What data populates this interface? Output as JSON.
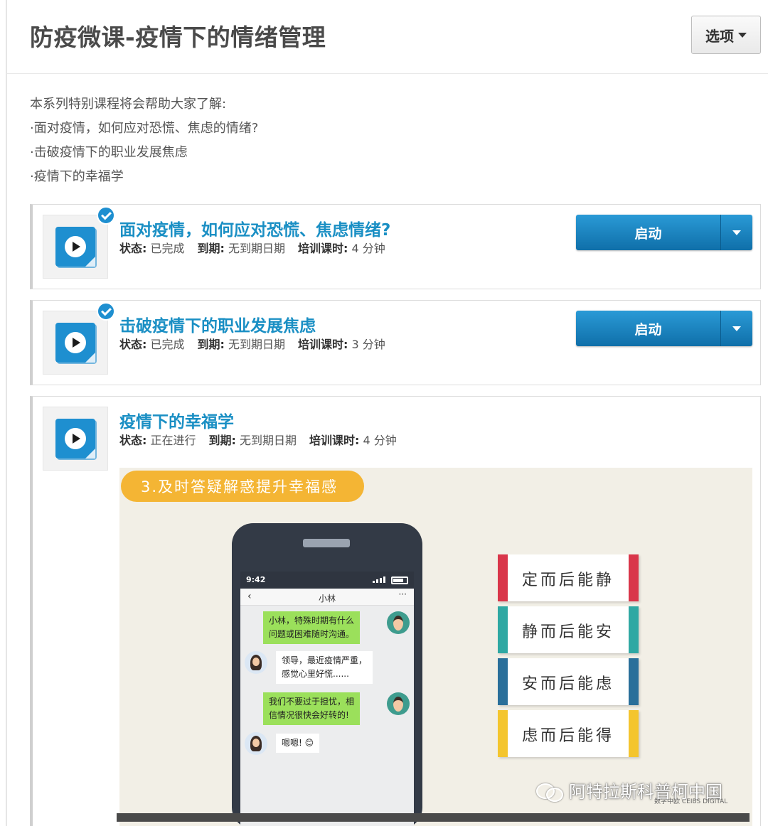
{
  "header": {
    "title": "防疫微课-疫情下的情绪管理",
    "options_label": "选项"
  },
  "description": {
    "lines": [
      "本系列特别课程将会帮助大家了解:",
      "·面对疫情，如何应对恐慌、焦虑的情绪?",
      "·击破疫情下的职业发展焦虑",
      "·疫情下的幸福学"
    ]
  },
  "meta_labels": {
    "status": "状态:",
    "due": "到期:",
    "duration": "培训课时:"
  },
  "courses": [
    {
      "title": "面对疫情，如何应对恐慌、焦虑情绪?",
      "status": "已完成",
      "due": "无到期日期",
      "duration": "4 分钟",
      "completed": true,
      "launch_label": "启动"
    },
    {
      "title": "击破疫情下的职业发展焦虑",
      "status": "已完成",
      "due": "无到期日期",
      "duration": "3 分钟",
      "completed": true,
      "launch_label": "启动"
    },
    {
      "title": "疫情下的幸福学",
      "status": "正在进行",
      "due": "无到期日期",
      "duration": "4 分钟",
      "completed": false
    }
  ],
  "video": {
    "banner": "3.及时答疑解惑提升幸福感",
    "phone": {
      "time": "9:42",
      "contact": "小林",
      "back": "‹",
      "more": "···",
      "messages": [
        {
          "text": "小林，特殊时期有什么\n问题或困难随时沟通。",
          "side": "right"
        },
        {
          "text": "领导，最近疫情严重，\n感觉心里好慌......",
          "side": "left"
        },
        {
          "text": "我们不要过于担忧，相\n信情况很快会好转的!",
          "side": "right"
        },
        {
          "text": "嗯嗯! 😊",
          "side": "left"
        }
      ]
    },
    "phrases": [
      {
        "text": "定而后能静",
        "color": "#d9364a"
      },
      {
        "text": "静而后能安",
        "color": "#2fa8a3"
      },
      {
        "text": "安而后能虑",
        "color": "#2a6f9a"
      },
      {
        "text": "虑而后能得",
        "color": "#f4c52e"
      }
    ]
  },
  "watermark": {
    "text": "阿特拉斯科普柯中国",
    "logo_text": "数字中欧",
    "logo_sub": "CEIBS DIGITAL"
  },
  "colors": {
    "accent": "#1a8fc4",
    "button": "#1677b3",
    "banner": "#f4b534"
  }
}
